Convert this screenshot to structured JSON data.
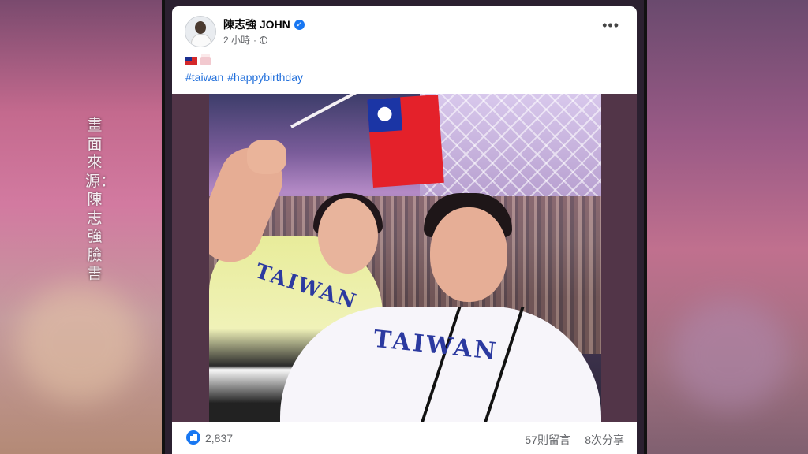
{
  "caption": {
    "text": "畫面來源：陳志強臉書"
  },
  "post": {
    "author": "陳志強 JOHN",
    "time": "2 小時",
    "separator": "·",
    "hashtags": [
      "#taiwan",
      "#happybirthday"
    ],
    "photo": {
      "shirt_text_left": "TAIWAN",
      "shirt_text_right": "TAIWAN"
    },
    "footer": {
      "likes": "2,837",
      "comments": "57則留言",
      "shares": "8次分享"
    }
  },
  "icons": {
    "verified": "verified-badge-icon",
    "audience": "globe-icon",
    "more": "more-options-icon",
    "like": "like-thumb-icon",
    "emoji_flag": "taiwan-flag-emoji",
    "emoji_cake": "birthday-cake-emoji"
  },
  "colors": {
    "link": "#216fdb",
    "facebook_blue": "#1877f2",
    "muted_text": "#65676b"
  }
}
